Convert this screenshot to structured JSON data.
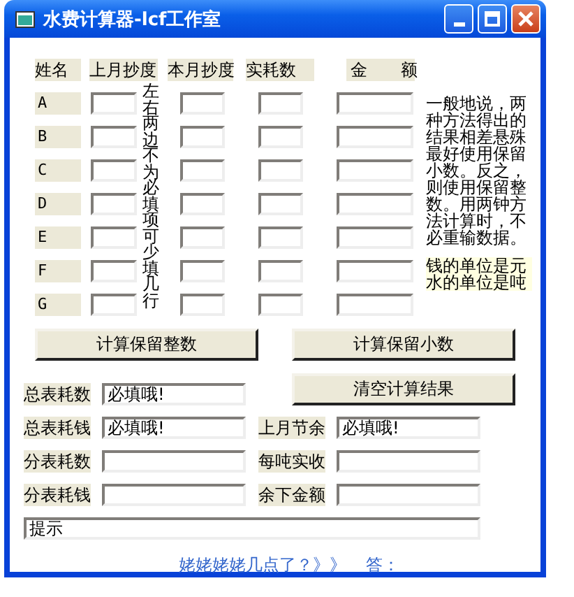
{
  "window": {
    "title": "水费计算器-lcf工作室"
  },
  "table": {
    "columns": [
      "姓名",
      "上月抄度",
      "本月抄度",
      "实耗数",
      "金　　额"
    ],
    "rows": [
      {
        "name": "A"
      },
      {
        "name": "B"
      },
      {
        "name": "C"
      },
      {
        "name": "D"
      },
      {
        "name": "E"
      },
      {
        "name": "F"
      },
      {
        "name": "G"
      }
    ]
  },
  "vertical_note": "左右两边不为必填项可少填几行",
  "notes": [
    {
      "text": "一般地说，两种方法得出的结果相差悬殊最好使用保留小数。反之，则使用保留整数。用两钟方法计算时，不必重输数据。",
      "highlighted": false
    },
    {
      "text": "钱的单位是元水的单位是吨",
      "highlighted": true
    }
  ],
  "buttons": [
    "计算保留整数",
    "计算保留小数"
  ],
  "clear_button": "清空计算结果",
  "summary": [
    {
      "label": "总表耗数",
      "value": "必填哦!"
    },
    {
      "label": "总表耗钱",
      "value": "必填哦!"
    },
    {
      "label": "上月节余",
      "value": "必填哦!"
    },
    {
      "label": "分表耗数"
    },
    {
      "label": "每吨实收"
    },
    {
      "label": "分表耗钱"
    },
    {
      "label": "余下金额"
    }
  ],
  "hint": {
    "value": "提示"
  },
  "footer": {
    "link": "姥姥姥姥几点了？》》",
    "answer_label": "答："
  }
}
